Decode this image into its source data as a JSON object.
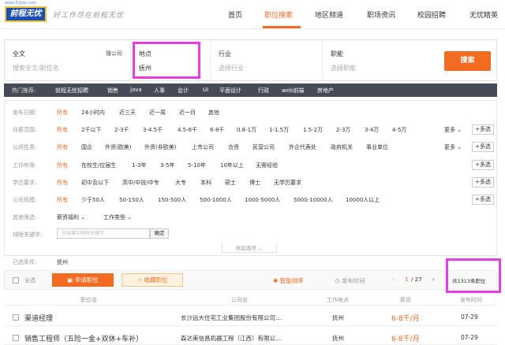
{
  "header": {
    "logo_url": "www.51job.com",
    "logo_text": "前程无忧",
    "slogan": "好工作尽在前程无忧",
    "nav": [
      "首页",
      "职位搜索",
      "地区频道",
      "职场资讯",
      "校园招聘",
      "无忧精英"
    ],
    "active_nav": "职位搜索"
  },
  "search": {
    "fulltext_label": "全文",
    "fulltext_placeholder": "搜索全文/职位名",
    "fulltext_tag": "搜公司",
    "location_label": "地点",
    "location_value": "抚州",
    "industry_label": "行业",
    "industry_placeholder": "选择行业",
    "function_label": "职能",
    "function_placeholder": "选择职能",
    "search_button": "搜索"
  },
  "hot": {
    "label": "热门推荐:",
    "items": [
      "前程无忧招聘",
      "销售",
      "java",
      "人事",
      "会计",
      "UI",
      "平面设计",
      "行政",
      "web前端",
      "房地产"
    ]
  },
  "filters": {
    "publish_date": {
      "label": "发布日期:",
      "options": [
        "所有",
        "24小时内",
        "近三天",
        "近一周",
        "近一月",
        "其他"
      ]
    },
    "salary": {
      "label": "月薪范围:",
      "options": [
        "所有",
        "2千以下",
        "2-3千",
        "3-4.5千",
        "4.5-6千",
        "6-8千",
        "0.8-1万",
        "1-1.5万",
        "1.5-2万",
        "2-3万",
        "3-4万",
        "4-5万"
      ]
    },
    "company_type": {
      "label": "公司性质:",
      "options": [
        "所有",
        "国企",
        "外资(欧美)",
        "外资(非欧美)",
        "上市公司",
        "合资",
        "民营公司",
        "外企代表处",
        "政府机关",
        "事业单位"
      ]
    },
    "experience": {
      "label": "工作年限:",
      "options": [
        "所有",
        "在校生/应届生",
        "1-3年",
        "3-5年",
        "5-10年",
        "10年以上",
        "无需经验"
      ]
    },
    "education": {
      "label": "学历要求:",
      "options": [
        "所有",
        "初中及以下",
        "高中/中技/中专",
        "大专",
        "本科",
        "硕士",
        "博士",
        "无学历要求"
      ]
    },
    "company_size": {
      "label": "公司规模:",
      "options": [
        "所有",
        "少于50人",
        "50-150人",
        "150-500人",
        "500-1000人",
        "1000-5000人",
        "5000-10000人",
        "10000人以上"
      ]
    },
    "other": {
      "label": "其他筛选:",
      "dropdowns": [
        "薪资福利",
        "工作类型"
      ]
    },
    "exclude": {
      "label": "排除关键字:",
      "placeholder": "在结果中排除关键字",
      "button": "确定"
    },
    "more": "更多",
    "multi": "+多选",
    "collapse": "收起选项"
  },
  "results": {
    "condition_label": "已选条件:",
    "condition_value": "抚州",
    "select_all": "全选",
    "apply_button": "申请职位",
    "fav_button": "收藏职位",
    "sort_smart": "智能排序",
    "sort_time": "发布时间",
    "page_current": "1",
    "page_total": "/ 27",
    "total_count": "共1313条职位",
    "columns": [
      "职位名",
      "公司名",
      "工作地点",
      "薪资",
      "发布时间"
    ],
    "rows": [
      {
        "title": "渠道经理",
        "company": "长沙远大住宅工业集团股份有限公司...",
        "location": "抚州",
        "salary": "6-8千/月",
        "date": "07-29"
      },
      {
        "title": "销售工程师（五险一金+双休+车补）",
        "company": "森达美信昌机器工程（江西）有限公...",
        "location": "抚州",
        "salary": "6-8千/月",
        "date": "07-29"
      }
    ]
  },
  "colors": {
    "accent": "#f26b21",
    "highlight": "#e83ce3",
    "hotbar": "#474b57"
  }
}
